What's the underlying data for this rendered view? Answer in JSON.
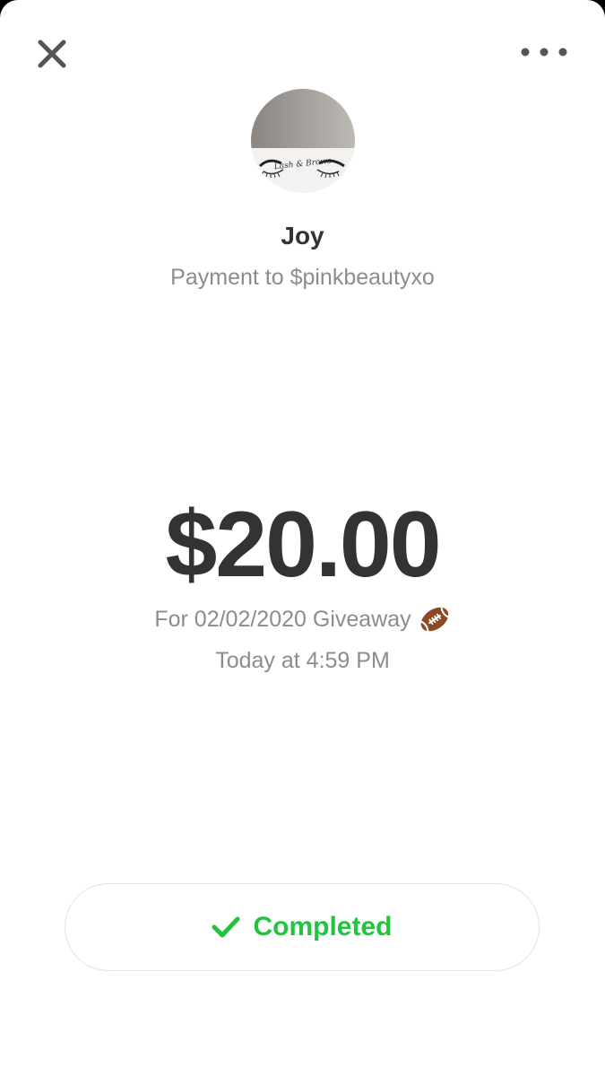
{
  "recipient": {
    "name": "Joy",
    "subtitle": "Payment to $pinkbeautyxo",
    "avatar_text": "Lash & Brows"
  },
  "payment": {
    "amount": "$20.00",
    "note": "For 02/02/2020 Giveaway",
    "note_emoji": "football-icon",
    "timestamp": "Today at 4:59 PM"
  },
  "status": {
    "label": "Completed",
    "icon": "check-icon",
    "color": "#1fc53b"
  },
  "header": {
    "close_icon": "close-icon",
    "more_icon": "more-icon"
  }
}
